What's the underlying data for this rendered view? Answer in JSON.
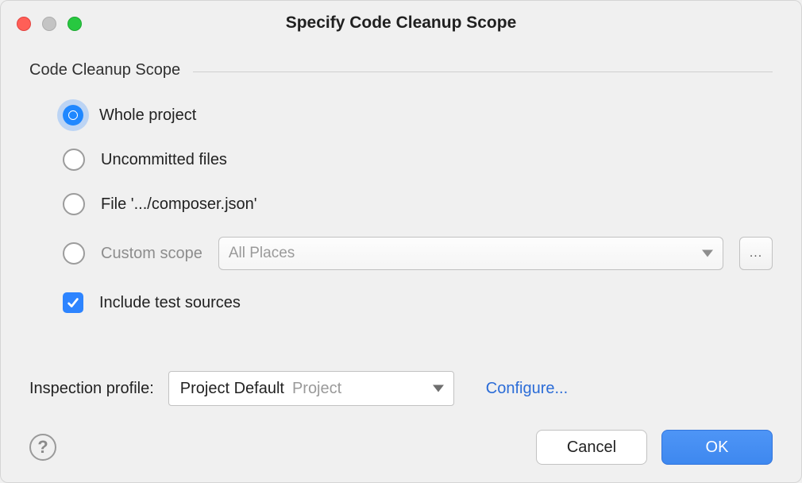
{
  "window": {
    "title": "Specify Code Cleanup Scope"
  },
  "section": {
    "title": "Code Cleanup Scope"
  },
  "options": {
    "whole_project": {
      "label": "Whole project",
      "selected": true
    },
    "uncommitted_files": {
      "label": "Uncommitted files",
      "selected": false
    },
    "file": {
      "label": "File '.../composer.json'",
      "selected": false
    },
    "custom_scope": {
      "label": "Custom scope",
      "selected": false,
      "dropdown_value": "All Places",
      "ellipsis": "..."
    }
  },
  "include_tests": {
    "label": "Include test sources",
    "checked": true
  },
  "profile": {
    "label": "Inspection profile:",
    "selected_name": "Project Default",
    "selected_scope": "Project",
    "configure_label": "Configure..."
  },
  "buttons": {
    "help": "?",
    "cancel": "Cancel",
    "ok": "OK"
  }
}
